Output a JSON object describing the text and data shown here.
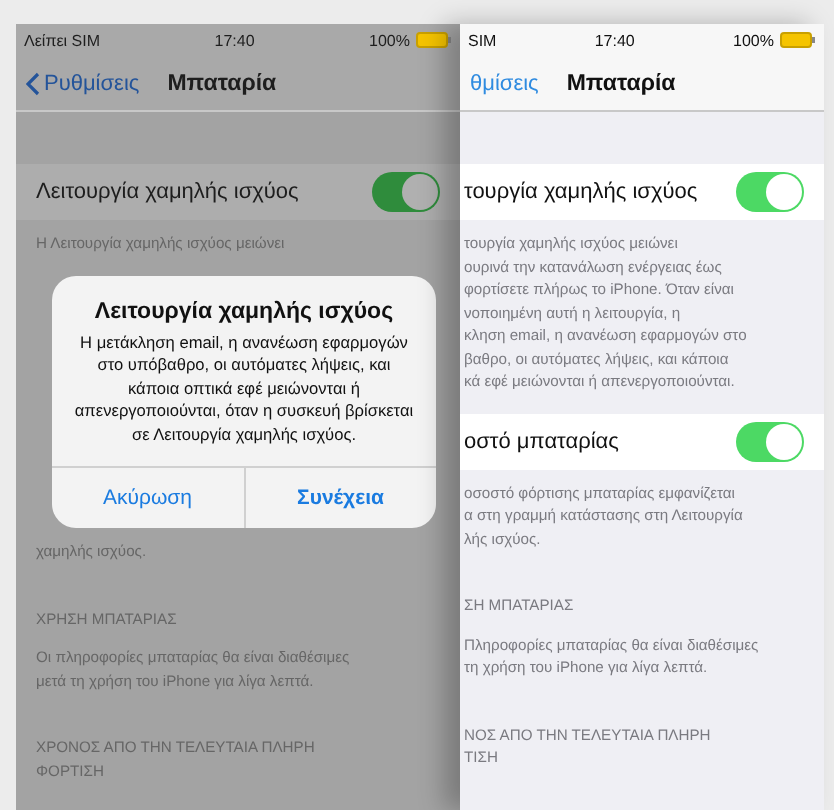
{
  "panels": [
    {
      "dimmed": true,
      "status": {
        "carrier": "Λείπει SIM",
        "time": "17:40",
        "battery": "100%"
      },
      "nav": {
        "back": "Ρυθμίσεις",
        "title": "Μπαταρία"
      },
      "sections": [
        {
          "kind": "toggle-row",
          "label": "Λειτουργία χαμηλής ισχύος",
          "on": true
        },
        {
          "kind": "footer",
          "lines": [
            "Η Λειτουργία χαμηλής ισχύος μειώνει"
          ]
        },
        {
          "kind": "alert",
          "title": "Λειτουργία χαμηλής ισχύος",
          "message": "Η μετάκληση email, η ανανέωση εφαρμογών στο υπόβαθρο, οι αυτόματες λήψεις, και κάποια οπτικά εφέ μειώνονται ή απενεργοποιούνται, όταν η συσκευή βρίσκεται σε Λειτουργία χαμηλής ισχύος.",
          "buttons": [
            {
              "label": "Ακύρωση",
              "bold": false
            },
            {
              "label": "Συνέχεια",
              "bold": true
            }
          ]
        },
        {
          "kind": "footer",
          "lines": [
            "χαμηλής ισχύος."
          ]
        },
        {
          "kind": "header",
          "lines": [
            "ΧΡΗΣΗ ΜΠΑΤΑΡΙΑΣ"
          ]
        },
        {
          "kind": "footer",
          "lines": [
            "Οι πληροφορίες μπαταρίας θα είναι διαθέσιμες",
            "μετά τη χρήση του iPhone για λίγα λεπτά."
          ]
        },
        {
          "kind": "header",
          "lines": [
            "ΧΡΟΝΟΣ ΑΠΟ ΤΗΝ ΤΕΛΕΥΤΑΙΑ ΠΛΗΡΗ",
            "ΦΟΡΤΙΣΗ"
          ]
        }
      ]
    },
    {
      "dimmed": false,
      "status": {
        "carrier": "SIM",
        "time": "17:40",
        "battery": "100%"
      },
      "nav": {
        "back": "θμίσεις",
        "title": "Μπαταρία"
      },
      "sections": [
        {
          "kind": "toggle-row",
          "label": "τουργία χαμηλής ισχύος",
          "on": true
        },
        {
          "kind": "footer",
          "lines": [
            "τουργία χαμηλής ισχύος μειώνει",
            "ουρινά την κατανάλωση ενέργειας έως",
            "φορτίσετε πλήρως το iPhone. Όταν είναι",
            "νοποιημένη αυτή η λειτουργία, η",
            "κληση email, η ανανέωση εφαρμογών στο",
            "βαθρο, οι αυτόματες λήψεις, και κάποια",
            "κά εφέ μειώνονται ή απενεργοποιούνται."
          ]
        },
        {
          "kind": "toggle-row",
          "label": "οστό μπαταρίας",
          "on": true
        },
        {
          "kind": "footer",
          "lines": [
            "οσοστό φόρτισης μπαταρίας εμφανίζεται",
            "α στη γραμμή κατάστασης στη Λειτουργία",
            "λής ισχύος."
          ]
        },
        {
          "kind": "header",
          "lines": [
            "ΣΗ ΜΠΑΤΑΡΙΑΣ"
          ]
        },
        {
          "kind": "footer",
          "lines": [
            "Πληροφορίες μπαταρίας θα είναι διαθέσιμες",
            "τη χρήση του iPhone για λίγα λεπτά."
          ]
        },
        {
          "kind": "header",
          "lines": [
            "ΝΟΣ ΑΠΟ ΤΗΝ ΤΕΛΕΥΤΑΙΑ ΠΛΗΡΗ",
            "ΤΙΣΗ"
          ]
        }
      ]
    }
  ]
}
